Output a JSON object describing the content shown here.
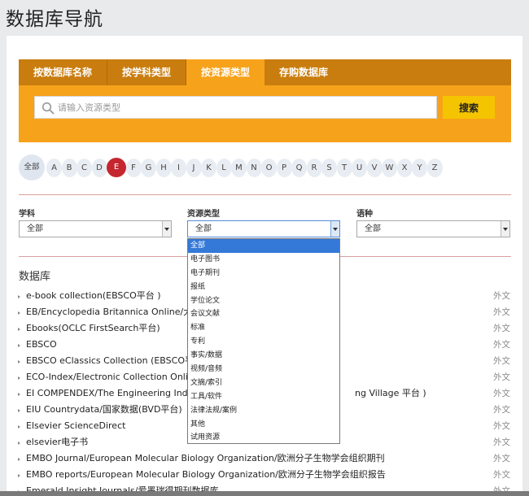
{
  "page_title": "数据库导航",
  "tabs": [
    {
      "label": "按数据库名称",
      "active": false
    },
    {
      "label": "按学科类型",
      "active": false
    },
    {
      "label": "按资源类型",
      "active": true
    },
    {
      "label": "存购数据库",
      "active": false
    }
  ],
  "search": {
    "placeholder": "请输入资源类型",
    "value": "",
    "button_label": "搜索"
  },
  "letters": {
    "all_label": "全部",
    "items": [
      "A",
      "B",
      "C",
      "D",
      "E",
      "F",
      "G",
      "H",
      "I",
      "J",
      "K",
      "L",
      "M",
      "N",
      "O",
      "P",
      "Q",
      "R",
      "S",
      "T",
      "U",
      "V",
      "W",
      "X",
      "Y",
      "Z"
    ],
    "active": "E"
  },
  "filters": {
    "subject": {
      "label": "学科",
      "value": "全部"
    },
    "resource_type": {
      "label": "资源类型",
      "value": "全部"
    },
    "language": {
      "label": "语种",
      "value": "全部"
    }
  },
  "resource_type_options": [
    "全部",
    "电子图书",
    "电子期刊",
    "报纸",
    "学位论文",
    "会议文献",
    "标准",
    "专利",
    "事实/数据",
    "视频/音频",
    "文摘/索引",
    "工具/软件",
    "法律法规/案例",
    "其他",
    "试用资源"
  ],
  "resource_type_selected_index": 0,
  "database_list": {
    "title": "数据库",
    "items": [
      {
        "name": "e-book collection(EBSCO平台 )",
        "lang": "外文"
      },
      {
        "name": "EB/Encyclopedia Britannica Online/大英百",
        "lang": "外文"
      },
      {
        "name": "Ebooks(OCLC FirstSearch平台)",
        "lang": "外文"
      },
      {
        "name": "EBSCO",
        "lang": "外文"
      },
      {
        "name": "EBSCO eClassics Collection (EBSCO平台 )",
        "lang": "外文"
      },
      {
        "name": "ECO-Index/Electronic Collection Online(O",
        "lang": "外文"
      },
      {
        "name": "EI COMPENDEX/The Engineering Index C",
        "name_tail": "ng Village 平台 )",
        "lang": "外文"
      },
      {
        "name": "EIU Countrydata/国家数据(BVD平台)",
        "lang": "外文"
      },
      {
        "name": "Elsevier ScienceDirect",
        "lang": "外文"
      },
      {
        "name": "elsevier电子书",
        "lang": "外文"
      },
      {
        "name": "EMBO Journal/European Molecular Biology Organization/欧洲分子生物学会组织期刊",
        "lang": "外文"
      },
      {
        "name": "EMBO reports/European Molecular Biology Organization/欧洲分子生物学会组织报告",
        "lang": "外文"
      },
      {
        "name": "Emerald Insight Journals/爱墨瑞得期刊数据库",
        "lang": "外文"
      }
    ]
  },
  "colors": {
    "accent_orange": "#f7a21b",
    "tab_bar": "#c97d0f",
    "search_button": "#f5c400",
    "active_letter": "#c52630",
    "dropdown_highlight": "#3479d8"
  }
}
